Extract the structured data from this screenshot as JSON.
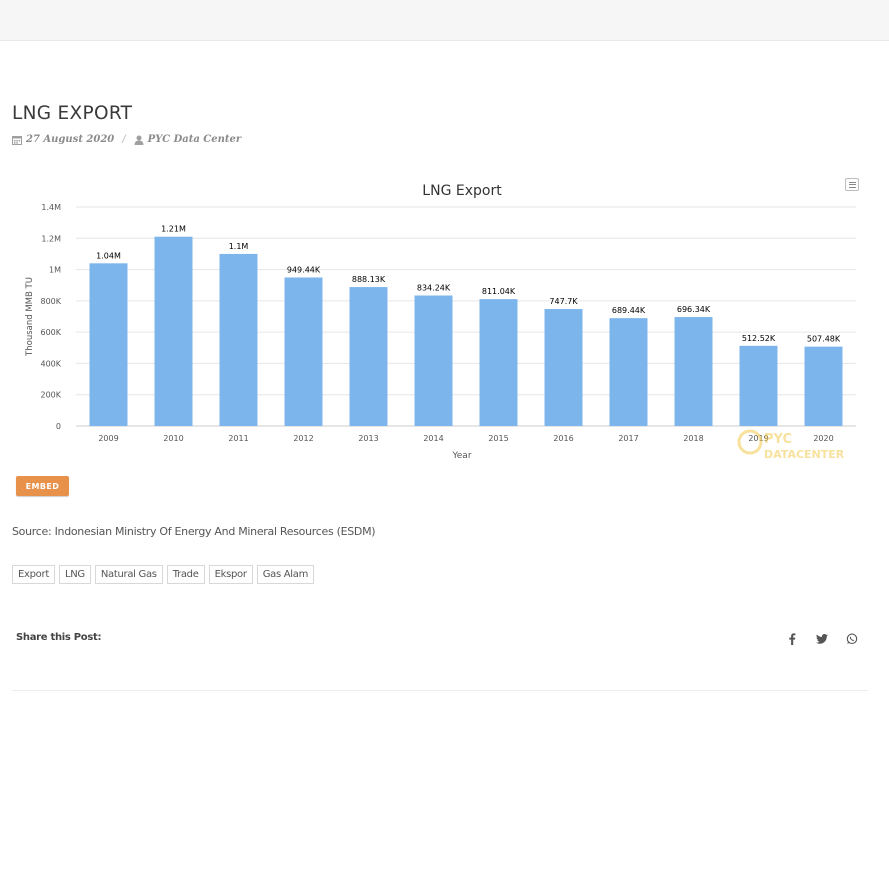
{
  "post": {
    "title": "LNG EXPORT",
    "date": "27 August 2020",
    "separator": "/",
    "author": "PYC Data Center",
    "date_icon": "calendar-icon",
    "author_icon": "user-icon"
  },
  "chart_data": {
    "type": "bar",
    "title": "LNG Export",
    "xlabel": "Year",
    "ylabel": "Thousand MMB TU",
    "categories": [
      "2009",
      "2010",
      "2011",
      "2012",
      "2013",
      "2014",
      "2015",
      "2016",
      "2017",
      "2018",
      "2019",
      "2020"
    ],
    "values": [
      1040000,
      1210000,
      1100000,
      949440,
      888130,
      834240,
      811040,
      747700,
      689440,
      696340,
      512520,
      507480
    ],
    "data_labels": [
      "1.04M",
      "1.21M",
      "1.1M",
      "949.44K",
      "888.13K",
      "834.24K",
      "811.04K",
      "747.7K",
      "689.44K",
      "696.34K",
      "512.52K",
      "507.48K"
    ],
    "ylim": [
      0,
      1400000
    ],
    "yticks": [
      0,
      200000,
      400000,
      600000,
      800000,
      1000000,
      1200000,
      1400000
    ],
    "ytick_labels": [
      "0",
      "200K",
      "400K",
      "600K",
      "800K",
      "1M",
      "1.2M",
      "1.4M"
    ],
    "grid": true,
    "bar_color": "#7cb5ec",
    "watermark": "PYC DATA CENTER"
  },
  "chart_menu_icon": "hamburger-menu-icon",
  "embed_label": "EMBED",
  "embed_color": "#e8914b",
  "source": "Source: Indonesian Ministry Of Energy And Mineral Resources (ESDM)",
  "tags": [
    "Export",
    "LNG",
    "Natural Gas",
    "Trade",
    "Ekspor",
    "Gas Alam"
  ],
  "share": {
    "label": "Share this Post:",
    "icons": [
      "facebook-icon",
      "twitter-icon",
      "whatsapp-icon"
    ]
  }
}
